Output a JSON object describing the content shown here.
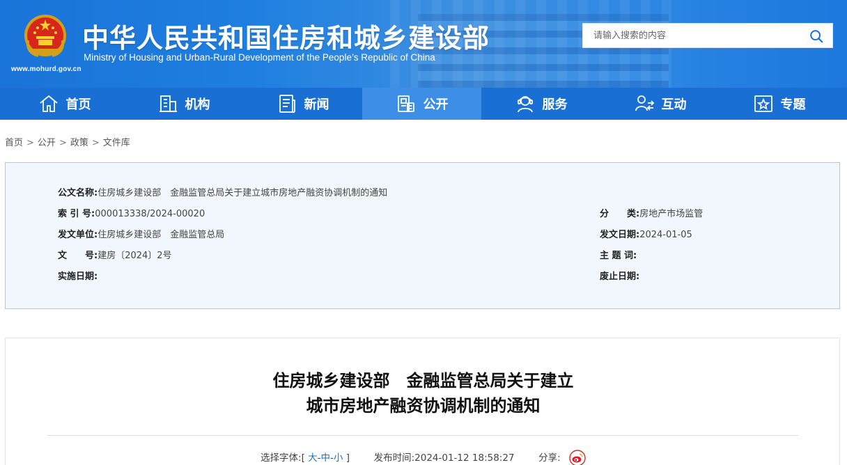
{
  "header": {
    "site_title": "中华人民共和国住房和城乡建设部",
    "site_subtitle": "Ministry of Housing and Urban-Rural Development of the People’s Republic of China",
    "site_url": "www.mohurd.gov.cn",
    "search_placeholder": "请输入搜索的内容",
    "colors": {
      "header_blue": "#1a73d8",
      "nav_blue": "#1a6fd4",
      "nav_active": "#3d8ee6"
    }
  },
  "nav": {
    "items": [
      {
        "label": "首页",
        "icon": "home-icon"
      },
      {
        "label": "机构",
        "icon": "building-icon"
      },
      {
        "label": "新闻",
        "icon": "newspaper-icon"
      },
      {
        "label": "公开",
        "icon": "document-icon",
        "active": true
      },
      {
        "label": "服务",
        "icon": "service-person-icon"
      },
      {
        "label": "互动",
        "icon": "interaction-icon"
      },
      {
        "label": "专题",
        "icon": "star-frame-icon"
      }
    ]
  },
  "breadcrumb": {
    "items": [
      "首页",
      "公开",
      "政策",
      "文件库"
    ],
    "separator": ">"
  },
  "info": {
    "title_label": "公文名称:",
    "title_value": "住房城乡建设部　金融监管总局关于建立城市房地产融资协调机制的通知",
    "index_label": "索 引 号:",
    "index_value": "000013338/2024-00020",
    "category_label": "分　　类:",
    "category_value": "房地产市场监管",
    "issuer_label": "发文单位:",
    "issuer_value": "住房城乡建设部　金融监管总局",
    "date_label": "发文日期:",
    "date_value": "2024-01-05",
    "docno_label": "文　　号:",
    "docno_value": "建房〔2024〕2号",
    "keywords_label": "主 题 词:",
    "keywords_value": "",
    "effective_label": "实施日期:",
    "effective_value": "",
    "expiry_label": "废止日期:",
    "expiry_value": ""
  },
  "article": {
    "title_line1": "住房城乡建设部　金融监管总局关于建立",
    "title_line2": "城市房地产融资协调机制的通知",
    "font_label": "选择字体:",
    "font_open": "[",
    "font_large": "大",
    "font_medium": "中",
    "font_small": "小",
    "font_dash": "-",
    "font_close": "]",
    "publish_label": "发布时间:",
    "publish_time": "2024-01-12 18:58:27",
    "share_label": "分享:",
    "share_icon": "weibo-icon"
  }
}
